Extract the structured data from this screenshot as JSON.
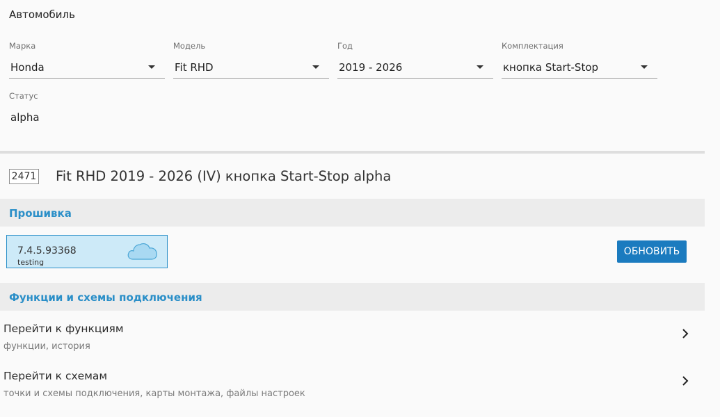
{
  "car": {
    "section_title": "Автомобиль",
    "fields": [
      {
        "label": "Марка",
        "value": "Honda"
      },
      {
        "label": "Модель",
        "value": "Fit RHD"
      },
      {
        "label": "Год",
        "value": "2019 - 2026"
      },
      {
        "label": "Комплектация",
        "value": "кнопка Start-Stop"
      }
    ],
    "status": {
      "label": "Статус",
      "value": "alpha"
    }
  },
  "summary": {
    "id": "2471",
    "title": "Fit RHD 2019 - 2026 (IV) кнопка Start-Stop alpha"
  },
  "firmware": {
    "section_title": "Прошивка",
    "version": "7.4.5.93368",
    "channel": "testing",
    "icon": "cloud-icon",
    "update_label": "ОБНОВИТЬ"
  },
  "functions": {
    "section_title": "Функции и схемы подключения",
    "items": [
      {
        "title": "Перейти к функциям",
        "subtitle": "функции, история",
        "icon": "chevron-right-icon"
      },
      {
        "title": "Перейти к схемам",
        "subtitle": "точки и схемы подключения, карты монтажа, файлы настроек",
        "icon": "chevron-right-icon"
      }
    ]
  },
  "colors": {
    "accent": "#2b8fc8",
    "button": "#1b7bbf",
    "firmware_card": "#cdeaf8"
  }
}
